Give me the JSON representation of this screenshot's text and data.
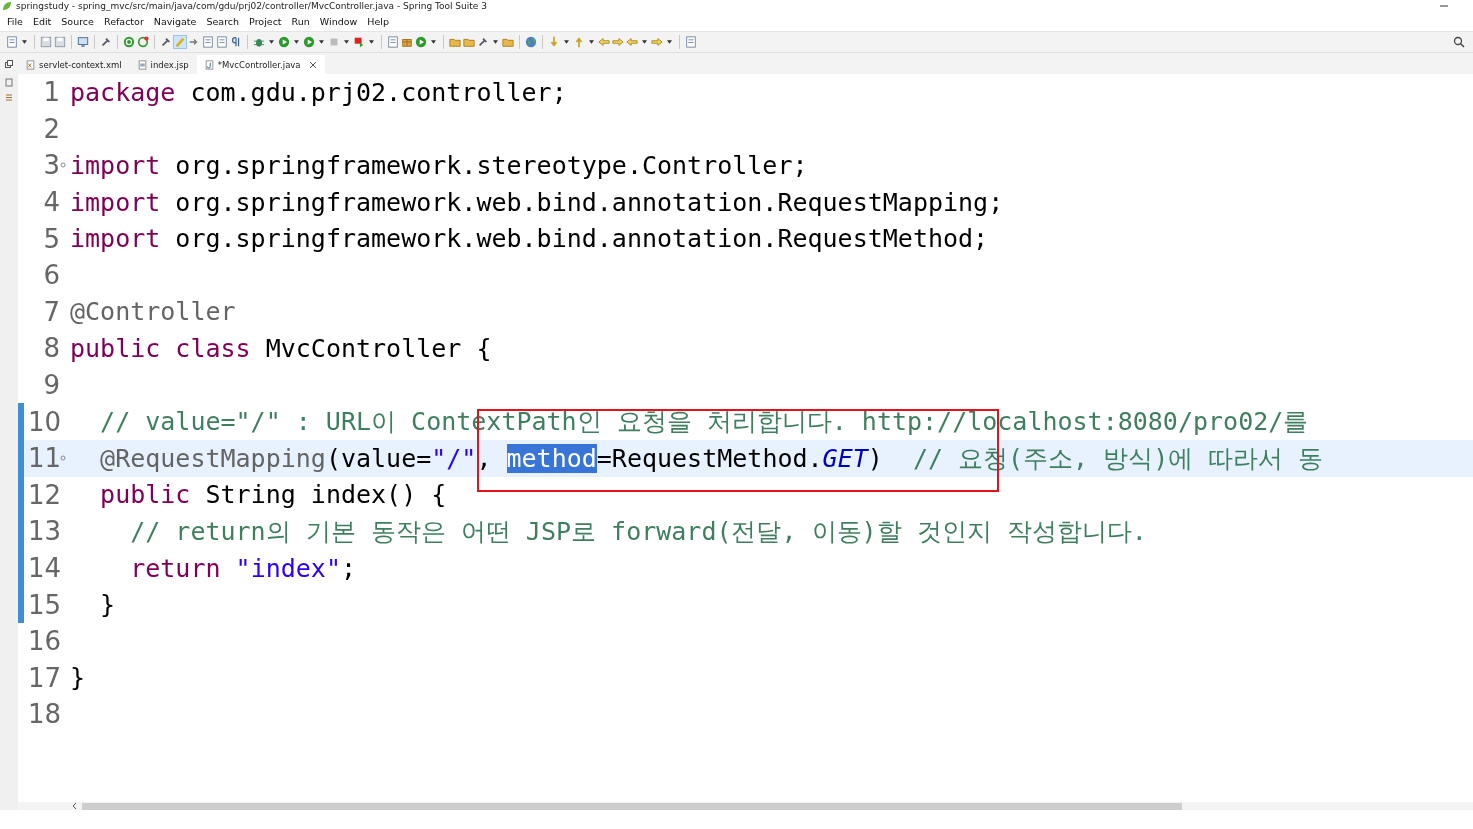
{
  "window": {
    "title": "springstudy - spring_mvc/src/main/java/com/gdu/prj02/controller/MvcController.java - Spring Tool Suite 3"
  },
  "menu": [
    "File",
    "Edit",
    "Source",
    "Refactor",
    "Navigate",
    "Search",
    "Project",
    "Run",
    "Window",
    "Help"
  ],
  "tabs": [
    {
      "label": "servlet-context.xml",
      "kind": "xml",
      "selected": false
    },
    {
      "label": "index.jsp",
      "kind": "jsp",
      "selected": false
    },
    {
      "label": "*MvcController.java",
      "kind": "java",
      "selected": true
    }
  ],
  "editor": {
    "lines": [
      {
        "number": "1",
        "changed": false,
        "fold": false,
        "current": false,
        "tokens": [
          {
            "kind": "keyword",
            "text": "package"
          },
          {
            "kind": "plain",
            "text": " com.gdu.prj02.controller;"
          }
        ]
      },
      {
        "number": "2",
        "changed": false,
        "fold": false,
        "current": false
      },
      {
        "number": "3",
        "changed": false,
        "fold": true,
        "current": false,
        "tokens": [
          {
            "kind": "keyword",
            "text": "import"
          },
          {
            "kind": "plain",
            "text": " org.springframework.stereotype.Controller;"
          }
        ]
      },
      {
        "number": "4",
        "changed": false,
        "fold": false,
        "current": false,
        "tokens": [
          {
            "kind": "keyword",
            "text": "import"
          },
          {
            "kind": "plain",
            "text": " org.springframework.web.bind.annotation.RequestMapping;"
          }
        ]
      },
      {
        "number": "5",
        "changed": false,
        "fold": false,
        "current": false,
        "tokens": [
          {
            "kind": "keyword",
            "text": "import"
          },
          {
            "kind": "plain",
            "text": " org.springframework.web.bind.annotation.RequestMethod;"
          }
        ]
      },
      {
        "number": "6",
        "changed": false,
        "fold": false,
        "current": false
      },
      {
        "number": "7",
        "changed": false,
        "fold": false,
        "current": false,
        "tokens": [
          {
            "kind": "annotation",
            "text": "@Controller"
          }
        ]
      },
      {
        "number": "8",
        "changed": false,
        "fold": false,
        "current": false,
        "tokens": [
          {
            "kind": "keyword",
            "text": "public class"
          },
          {
            "kind": "plain",
            "text": " MvcController {"
          }
        ]
      },
      {
        "number": "9",
        "changed": false,
        "fold": false,
        "current": false
      },
      {
        "number": "10",
        "changed": true,
        "fold": false,
        "current": false,
        "tokens": [
          {
            "kind": "comment",
            "text": "  // value=\"/\" : URL이 ContextPath인 요청을 처리합니다. http://localhost:8080/pro02/를"
          }
        ]
      },
      {
        "number": "11",
        "changed": true,
        "fold": true,
        "current": true,
        "tokens": [
          {
            "kind": "annotation",
            "text": "  @RequestMapping"
          },
          {
            "kind": "plain",
            "text": "(value="
          },
          {
            "kind": "string",
            "text": "\"/\""
          },
          {
            "kind": "plain",
            "text": ", "
          },
          {
            "kind": "selection",
            "text": "method"
          },
          {
            "kind": "plain",
            "text": "=RequestMethod."
          },
          {
            "kind": "field",
            "text": "GET"
          },
          {
            "kind": "plain",
            "text": ")  "
          },
          {
            "kind": "comment",
            "text": "// 요청(주소, 방식)에 따라서 동"
          }
        ]
      },
      {
        "number": "12",
        "changed": true,
        "fold": false,
        "current": false,
        "tokens": [
          {
            "kind": "keyword",
            "text": "  public"
          },
          {
            "kind": "plain",
            "text": " String index() {"
          }
        ]
      },
      {
        "number": "13",
        "changed": true,
        "fold": false,
        "current": false,
        "tokens": [
          {
            "kind": "comment",
            "text": "    // return의 기본 동작은 어떤 JSP로 forward(전달, 이동)할 것인지 작성합니다."
          }
        ]
      },
      {
        "number": "14",
        "changed": true,
        "fold": false,
        "current": false,
        "tokens": [
          {
            "kind": "keyword",
            "text": "    return "
          },
          {
            "kind": "string",
            "text": "\"index\""
          },
          {
            "kind": "plain",
            "text": ";"
          }
        ]
      },
      {
        "number": "15",
        "changed": true,
        "fold": false,
        "current": false,
        "tokens": [
          {
            "kind": "plain",
            "text": "  }"
          }
        ]
      },
      {
        "number": "16",
        "changed": false,
        "fold": false,
        "current": false
      },
      {
        "number": "17",
        "changed": false,
        "fold": false,
        "current": false,
        "tokens": [
          {
            "kind": "plain",
            "text": "}"
          }
        ]
      },
      {
        "number": "18",
        "changed": false,
        "fold": false,
        "current": false
      }
    ]
  }
}
